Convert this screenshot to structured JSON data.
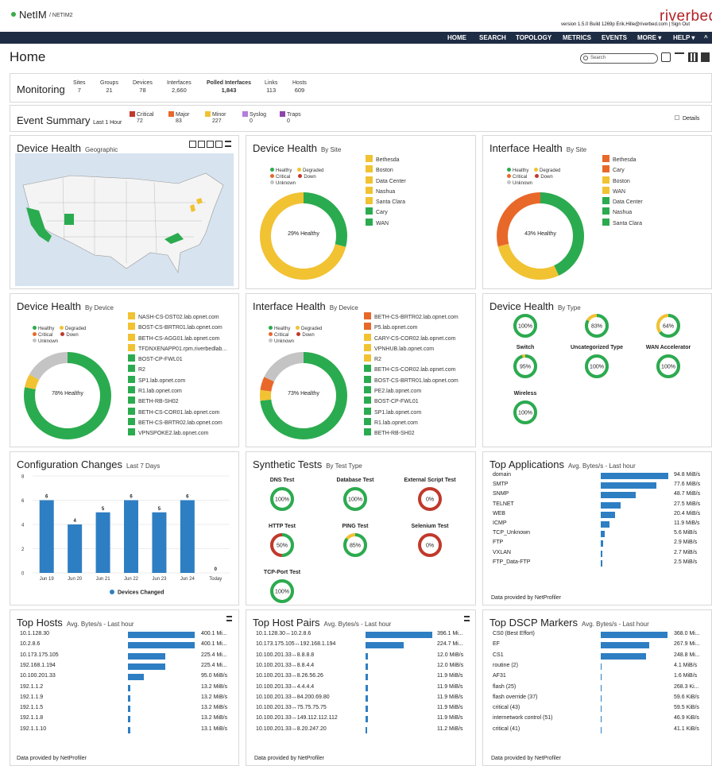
{
  "header": {
    "app_name": "NetIM",
    "app_sub": "/ NETIM2",
    "version": "version 1.5.0 Build 1269p  Erik.Hille@riverbed.com  |  Sign Out",
    "brand": "riverbed"
  },
  "nav": [
    "HOME",
    "SEARCH",
    "TOPOLOGY",
    "METRICS",
    "EVENTS",
    "MORE ▾",
    "HELP ▾",
    "^"
  ],
  "page_title": "Home",
  "search": {
    "placeholder": "Search"
  },
  "monitoring": {
    "title": "Monitoring",
    "stats": [
      {
        "label": "Sites",
        "value": "7"
      },
      {
        "label": "Groups",
        "value": "21"
      },
      {
        "label": "Devices",
        "value": "78"
      },
      {
        "label": "Interfaces",
        "value": "2,660"
      },
      {
        "label": "Polled Interfaces",
        "value": "1,843"
      },
      {
        "label": "Links",
        "value": "113"
      },
      {
        "label": "Hosts",
        "value": "609"
      }
    ]
  },
  "event_summary": {
    "title": "Event Summary",
    "subtitle": "Last 1 Hour",
    "details": "Details",
    "items": [
      {
        "label": "Critical",
        "value": "72",
        "color": "#c0392b"
      },
      {
        "label": "Major",
        "value": "83",
        "color": "#e8682a"
      },
      {
        "label": "Minor",
        "value": "227",
        "color": "#f1c232"
      },
      {
        "label": "Syslog",
        "value": "0",
        "color": "#b57edc"
      },
      {
        "label": "Traps",
        "value": "0",
        "color": "#8e44ad"
      }
    ]
  },
  "health_legend": {
    "healthy": "Healthy",
    "degraded": "Degraded",
    "critical": "Critical",
    "down": "Down",
    "unknown": "Unknown"
  },
  "colors": {
    "healthy": "#2bab4f",
    "degraded": "#f1c232",
    "critical": "#e8682a",
    "down": "#c0392b",
    "unknown": "#c4c4c4",
    "bar": "#2e7ec3"
  },
  "dh_geo": {
    "title": "Device Health",
    "subtitle": "Geographic"
  },
  "dh_site": {
    "title": "Device Health",
    "subtitle": "By Site",
    "center": "29% Healthy",
    "healthy_pct": 29,
    "segments": [
      {
        "v": 29,
        "c": "healthy"
      },
      {
        "v": 71,
        "c": "degraded"
      }
    ],
    "sites": [
      {
        "name": "Bethesda",
        "c": "degraded"
      },
      {
        "name": "Boston",
        "c": "degraded"
      },
      {
        "name": "Data Center",
        "c": "degraded"
      },
      {
        "name": "Nashua",
        "c": "degraded"
      },
      {
        "name": "Santa Clara",
        "c": "degraded"
      },
      {
        "name": "Cary",
        "c": "healthy"
      },
      {
        "name": "WAN",
        "c": "healthy"
      }
    ]
  },
  "ih_site": {
    "title": "Interface Health",
    "subtitle": "By Site",
    "center": "43% Healthy",
    "healthy_pct": 43,
    "segments": [
      {
        "v": 43,
        "c": "healthy"
      },
      {
        "v": 28,
        "c": "degraded"
      },
      {
        "v": 29,
        "c": "critical"
      }
    ],
    "sites": [
      {
        "name": "Bethesda",
        "c": "critical"
      },
      {
        "name": "Cary",
        "c": "critical"
      },
      {
        "name": "Boston",
        "c": "degraded"
      },
      {
        "name": "WAN",
        "c": "degraded"
      },
      {
        "name": "Data Center",
        "c": "healthy"
      },
      {
        "name": "Nashua",
        "c": "healthy"
      },
      {
        "name": "Santa Clara",
        "c": "healthy"
      }
    ]
  },
  "dh_device": {
    "title": "Device Health",
    "subtitle": "By Device",
    "center": "78% Healthy",
    "healthy_pct": 78,
    "segments": [
      {
        "v": 78,
        "c": "healthy"
      },
      {
        "v": 5,
        "c": "degraded"
      },
      {
        "v": 17,
        "c": "unknown"
      }
    ],
    "devices": [
      {
        "name": "NASH-CS-DST02.lab.opnet.com",
        "c": "degraded"
      },
      {
        "name": "BOST-CS-BRTR01.lab.opnet.com",
        "c": "degraded"
      },
      {
        "name": "BETH-CS-AGG01.lab.opnet.com",
        "c": "degraded"
      },
      {
        "name": "TFDNXENAPP01.rpm.riverbedlab...",
        "c": "degraded"
      },
      {
        "name": "BOST-CP-FWL01",
        "c": "healthy"
      },
      {
        "name": "R2",
        "c": "healthy"
      },
      {
        "name": "SP1.lab.opnet.com",
        "c": "healthy"
      },
      {
        "name": "R1.lab.opnet.com",
        "c": "healthy"
      },
      {
        "name": "BETH-RB-SH02",
        "c": "healthy"
      },
      {
        "name": "BETH-CS-COR01.lab.opnet.com",
        "c": "healthy"
      },
      {
        "name": "BETH-CS-BRTR02.lab.opnet.com",
        "c": "healthy"
      },
      {
        "name": "VPNSPOKE2.lab.opnet.com",
        "c": "healthy"
      }
    ]
  },
  "ih_device": {
    "title": "Interface Health",
    "subtitle": "By Device",
    "center": "73% Healthy",
    "healthy_pct": 73,
    "segments": [
      {
        "v": 73,
        "c": "healthy"
      },
      {
        "v": 4,
        "c": "degraded"
      },
      {
        "v": 5,
        "c": "critical"
      },
      {
        "v": 18,
        "c": "unknown"
      }
    ],
    "devices": [
      {
        "name": "BETH-CS-BRTR02.lab.opnet.com",
        "c": "critical"
      },
      {
        "name": "P5.lab.opnet.com",
        "c": "critical"
      },
      {
        "name": "CARY-CS-COR02.lab.opnet.com",
        "c": "degraded"
      },
      {
        "name": "VPNHUB.lab.opnet.com",
        "c": "degraded"
      },
      {
        "name": "R2",
        "c": "degraded"
      },
      {
        "name": "BETH-CS-COR02.lab.opnet.com",
        "c": "healthy"
      },
      {
        "name": "BOST-CS-BRTR01.lab.opnet.com",
        "c": "healthy"
      },
      {
        "name": "PE2.lab.opnet.com",
        "c": "healthy"
      },
      {
        "name": "BOST-CP-FWL01",
        "c": "healthy"
      },
      {
        "name": "SP1.lab.opnet.com",
        "c": "healthy"
      },
      {
        "name": "R1.lab.opnet.com",
        "c": "healthy"
      },
      {
        "name": "BETH-RB-SH02",
        "c": "healthy"
      }
    ]
  },
  "dh_type": {
    "title": "Device Health",
    "subtitle": "By Type",
    "types": [
      {
        "label": "",
        "value": "100%",
        "pct": 100
      },
      {
        "label": "Switch",
        "value": "83%",
        "pct": 83
      },
      {
        "label": "Uncategorized Type",
        "value": "64%",
        "pct": 64
      },
      {
        "label": "Wireless",
        "value": "95%",
        "pct": 95
      },
      {
        "label": "WAN Accelerator",
        "value": "100%",
        "pct": 100
      },
      {
        "label": "",
        "value": "100%",
        "pct": 100
      },
      {
        "label": "",
        "value": "100%",
        "pct": 100
      }
    ]
  },
  "config": {
    "title": "Configuration Changes",
    "subtitle": "Last 7 Days",
    "legend": "Devices Changed"
  },
  "synthetic": {
    "title": "Synthetic Tests",
    "subtitle": "By Test Type",
    "tests": [
      {
        "label": "DNS Test",
        "value": "100%",
        "pct": 100
      },
      {
        "label": "Database Test",
        "value": "100%",
        "pct": 100
      },
      {
        "label": "External Script Test",
        "value": "0%",
        "pct": 0
      },
      {
        "label": "HTTP Test",
        "value": "50%",
        "pct": 50
      },
      {
        "label": "PING Test",
        "value": "85%",
        "pct": 85
      },
      {
        "label": "Selenium Test",
        "value": "0%",
        "pct": 0
      },
      {
        "label": "TCP-Port Test",
        "value": "100%",
        "pct": 100
      }
    ]
  },
  "top_apps": {
    "title": "Top Applications",
    "subtitle": "Avg. Bytes/s - Last hour",
    "footer": "Data provided by NetProfiler",
    "rows": [
      {
        "label": "domain",
        "value": "94.8 MiB/s",
        "v": 94.8
      },
      {
        "label": "SMTP",
        "value": "77.6 MiB/s",
        "v": 77.6
      },
      {
        "label": "SNMP",
        "value": "48.7 MiB/s",
        "v": 48.7
      },
      {
        "label": "TELNET",
        "value": "27.5 MiB/s",
        "v": 27.5
      },
      {
        "label": "WEB",
        "value": "20.4 MiB/s",
        "v": 20.4
      },
      {
        "label": "ICMP",
        "value": "11.9 MiB/s",
        "v": 11.9
      },
      {
        "label": "TCP_Unknown",
        "value": "5.6 MiB/s",
        "v": 5.6
      },
      {
        "label": "FTP",
        "value": "2.9 MiB/s",
        "v": 2.9
      },
      {
        "label": "VXLAN",
        "value": "2.7 MiB/s",
        "v": 2.7
      },
      {
        "label": "FTP_Data-FTP",
        "value": "2.5 MiB/s",
        "v": 2.5
      }
    ]
  },
  "top_hosts": {
    "title": "Top Hosts",
    "subtitle": "Avg. Bytes/s - Last hour",
    "footer": "Data provided by NetProfiler",
    "rows": [
      {
        "label": "10.1.128.30",
        "value": "400.1 Mi...",
        "v": 400.1
      },
      {
        "label": "10.2.8.6",
        "value": "400.1 Mi...",
        "v": 400.1
      },
      {
        "label": "10.173.175.105",
        "value": "225.4 Mi...",
        "v": 225.4
      },
      {
        "label": "192.168.1.194",
        "value": "225.4 Mi...",
        "v": 225.4
      },
      {
        "label": "10.100.201.33",
        "value": "95.0 MiB/s",
        "v": 95.0
      },
      {
        "label": "192.1.1.2",
        "value": "13.2 MiB/s",
        "v": 13.2
      },
      {
        "label": "192.1.1.9",
        "value": "13.2 MiB/s",
        "v": 13.2
      },
      {
        "label": "192.1.1.5",
        "value": "13.2 MiB/s",
        "v": 13.2
      },
      {
        "label": "192.1.1.8",
        "value": "13.2 MiB/s",
        "v": 13.2
      },
      {
        "label": "192.1.1.10",
        "value": "13.1 MiB/s",
        "v": 13.1
      }
    ]
  },
  "top_pairs": {
    "title": "Top Host Pairs",
    "subtitle": "Avg. Bytes/s - Last hour",
    "footer": "Data provided by NetProfiler",
    "rows": [
      {
        "label": "10.1.128.30↔10.2.8.6",
        "value": "396.1 Mi...",
        "v": 396.1
      },
      {
        "label": "10.173.175.105↔192.168.1.194",
        "value": "224.7 Mi...",
        "v": 224.7
      },
      {
        "label": "10.100.201.33↔8.8.8.8",
        "value": "12.0 MiB/s",
        "v": 12.0
      },
      {
        "label": "10.100.201.33↔8.8.4.4",
        "value": "12.0 MiB/s",
        "v": 12.0
      },
      {
        "label": "10.100.201.33↔8.26.56.26",
        "value": "11.9 MiB/s",
        "v": 11.9
      },
      {
        "label": "10.100.201.33↔4.4.4.4",
        "value": "11.9 MiB/s",
        "v": 11.9
      },
      {
        "label": "10.100.201.33↔84.200.69.80",
        "value": "11.9 MiB/s",
        "v": 11.9
      },
      {
        "label": "10.100.201.33↔75.75.75.75",
        "value": "11.9 MiB/s",
        "v": 11.9
      },
      {
        "label": "10.100.201.33↔149.112.112.112",
        "value": "11.9 MiB/s",
        "v": 11.9
      },
      {
        "label": "10.100.201.33↔8.20.247.20",
        "value": "11.2 MiB/s",
        "v": 11.2
      }
    ]
  },
  "top_dscp": {
    "title": "Top DSCP Markers",
    "subtitle": "Avg. Bytes/s - Last hour",
    "footer": "Data provided by NetProfiler",
    "rows": [
      {
        "label": "CS0 (Best Effort)",
        "value": "368.0 Mi...",
        "v": 368.0
      },
      {
        "label": "EF",
        "value": "267.9 Mi...",
        "v": 267.9
      },
      {
        "label": "CS1",
        "value": "248.8 Mi...",
        "v": 248.8
      },
      {
        "label": "routine (2)",
        "value": "4.1 MiB/s",
        "v": 4.1
      },
      {
        "label": "AF31",
        "value": "1.6 MiB/s",
        "v": 1.6
      },
      {
        "label": "flash (25)",
        "value": "268.3 Ki...",
        "v": 0.3
      },
      {
        "label": "flash override (37)",
        "value": "59.6 KiB/s",
        "v": 0.06
      },
      {
        "label": "critical (43)",
        "value": "59.5 KiB/s",
        "v": 0.06
      },
      {
        "label": "internetwork control (51)",
        "value": "46.9 KiB/s",
        "v": 0.05
      },
      {
        "label": "critical (41)",
        "value": "41.1 KiB/s",
        "v": 0.04
      }
    ]
  },
  "chart_data": {
    "type": "bar",
    "categories": [
      "Jun 19",
      "Jun 20",
      "Jun 21",
      "Jun 22",
      "Jun 23",
      "Jun 24",
      "Today"
    ],
    "series": [
      {
        "name": "Devices Changed",
        "values": [
          6,
          4,
          5,
          6,
          5,
          6,
          0
        ]
      }
    ],
    "ylim": [
      0,
      8
    ],
    "yticks": [
      0,
      2,
      4,
      6,
      8
    ],
    "grid": true,
    "legend": "bottom"
  }
}
